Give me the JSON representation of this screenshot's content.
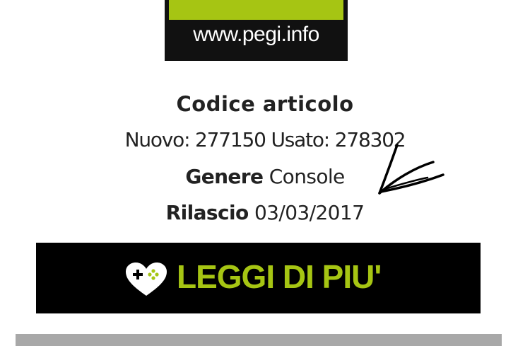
{
  "pegi": {
    "url": "www.pegi.info"
  },
  "article": {
    "title": "Codice articolo",
    "new_label": "Nuovo:",
    "new_code": "277150",
    "used_label": "Usato:",
    "used_code": "278302",
    "genre_label": "Genere",
    "genre_value": "Console",
    "release_label": "Rilascio",
    "release_value": "03/03/2017"
  },
  "button": {
    "label": "LEGGI DI PIU'",
    "icon": "heart-gamepad-icon"
  },
  "colors": {
    "accent": "#a6c513",
    "button_bg": "#000000",
    "pegi_bg": "#111111",
    "bar": "#a8a8a8"
  }
}
